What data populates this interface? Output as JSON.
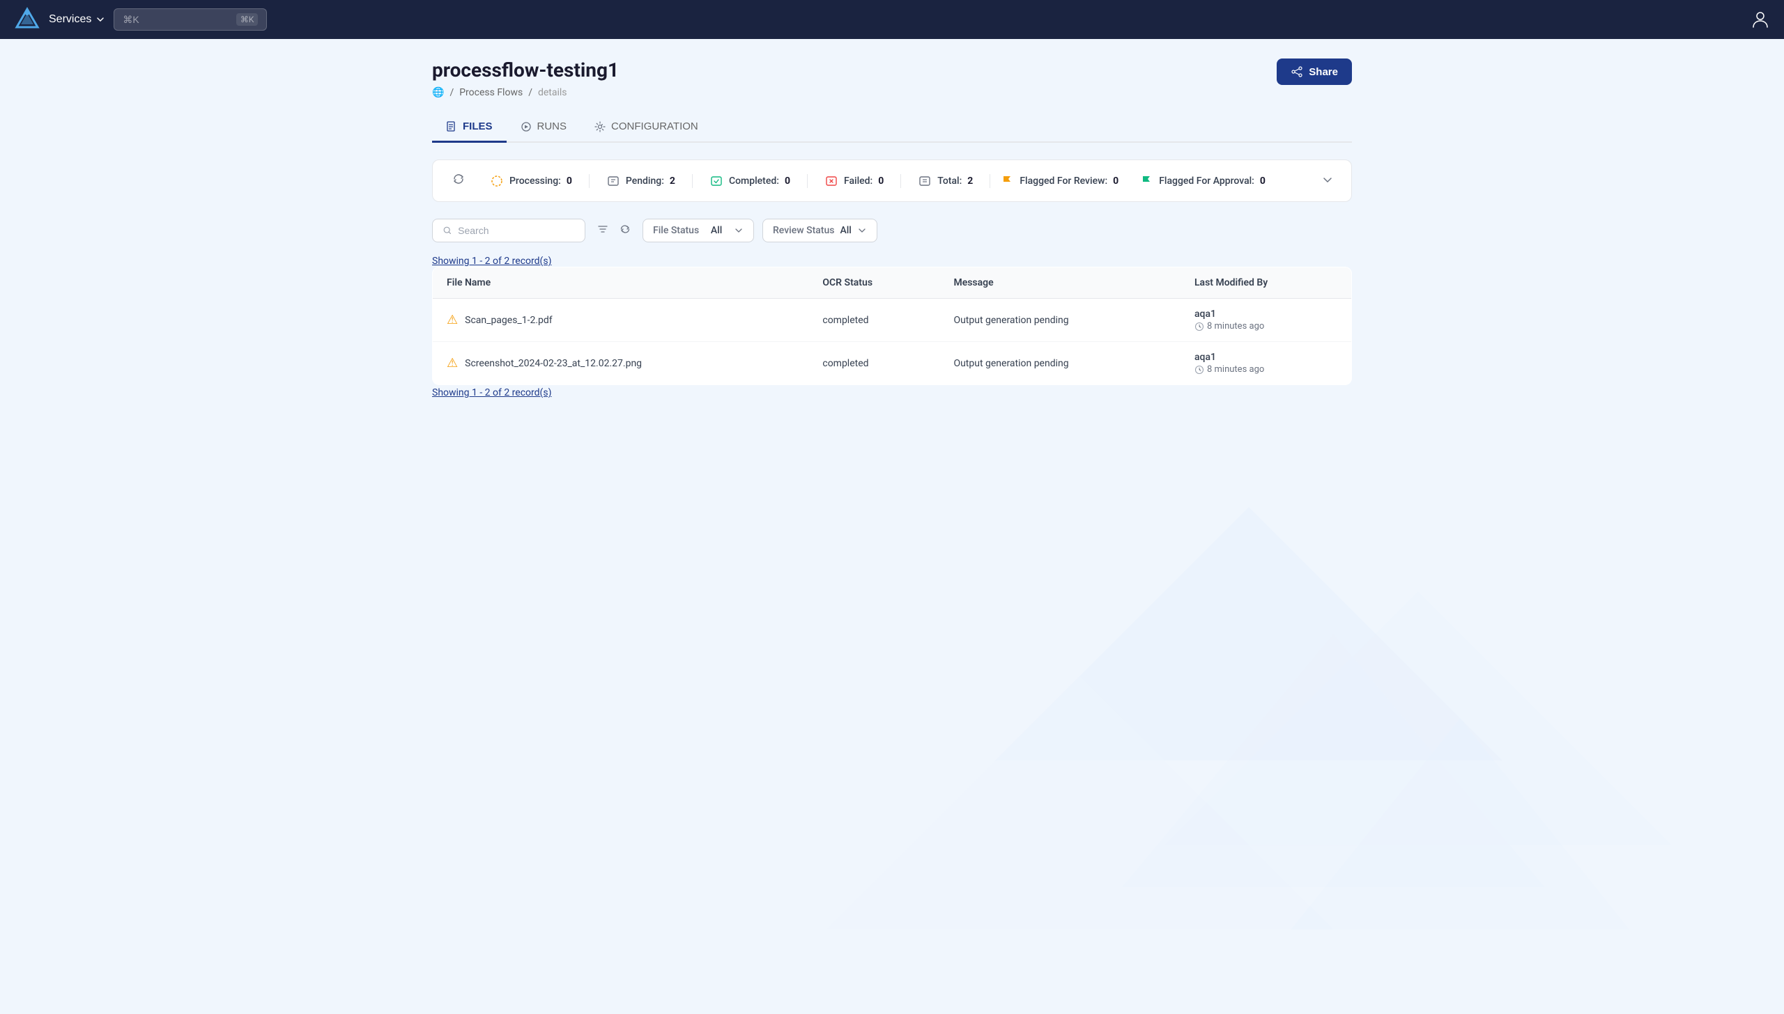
{
  "app": {
    "logo_alt": "Logo",
    "nav": {
      "services_label": "Services",
      "search_placeholder": "⌘K",
      "shortcut": "⌘K"
    }
  },
  "page": {
    "title": "processflow-testing1",
    "breadcrumb": {
      "home": "🌐",
      "process_flows": "Process Flows",
      "current": "details"
    },
    "share_button": "Share"
  },
  "tabs": [
    {
      "id": "files",
      "label": "FILES",
      "active": true
    },
    {
      "id": "runs",
      "label": "RUNS",
      "active": false
    },
    {
      "id": "configuration",
      "label": "CONFIGURATION",
      "active": false
    }
  ],
  "stats": {
    "processing_label": "Processing:",
    "processing_value": "0",
    "pending_label": "Pending:",
    "pending_value": "2",
    "completed_label": "Completed:",
    "completed_value": "0",
    "failed_label": "Failed:",
    "failed_value": "0",
    "total_label": "Total:",
    "total_value": "2",
    "flagged_review_label": "Flagged For Review:",
    "flagged_review_value": "0",
    "flagged_approval_label": "Flagged For Approval:",
    "flagged_approval_value": "0"
  },
  "filters": {
    "search_placeholder": "Search",
    "file_status_label": "File Status",
    "file_status_value": "All",
    "review_status_label": "Review Status",
    "review_status_value": "All"
  },
  "records": {
    "showing_top": "Showing 1 - 2 of 2 record(s)",
    "showing_bottom": "Showing 1 - 2 of 2 record(s)"
  },
  "table": {
    "headers": [
      "File Name",
      "OCR Status",
      "Message",
      "Last Modified By"
    ],
    "rows": [
      {
        "file_name": "Scan_pages_1-2.pdf",
        "ocr_status": "completed",
        "message": "Output generation pending",
        "modified_user": "aqa1",
        "modified_time": "8 minutes ago"
      },
      {
        "file_name": "Screenshot_2024-02-23_at_12.02.27.png",
        "ocr_status": "completed",
        "message": "Output generation pending",
        "modified_user": "aqa1",
        "modified_time": "8 minutes ago"
      }
    ]
  }
}
